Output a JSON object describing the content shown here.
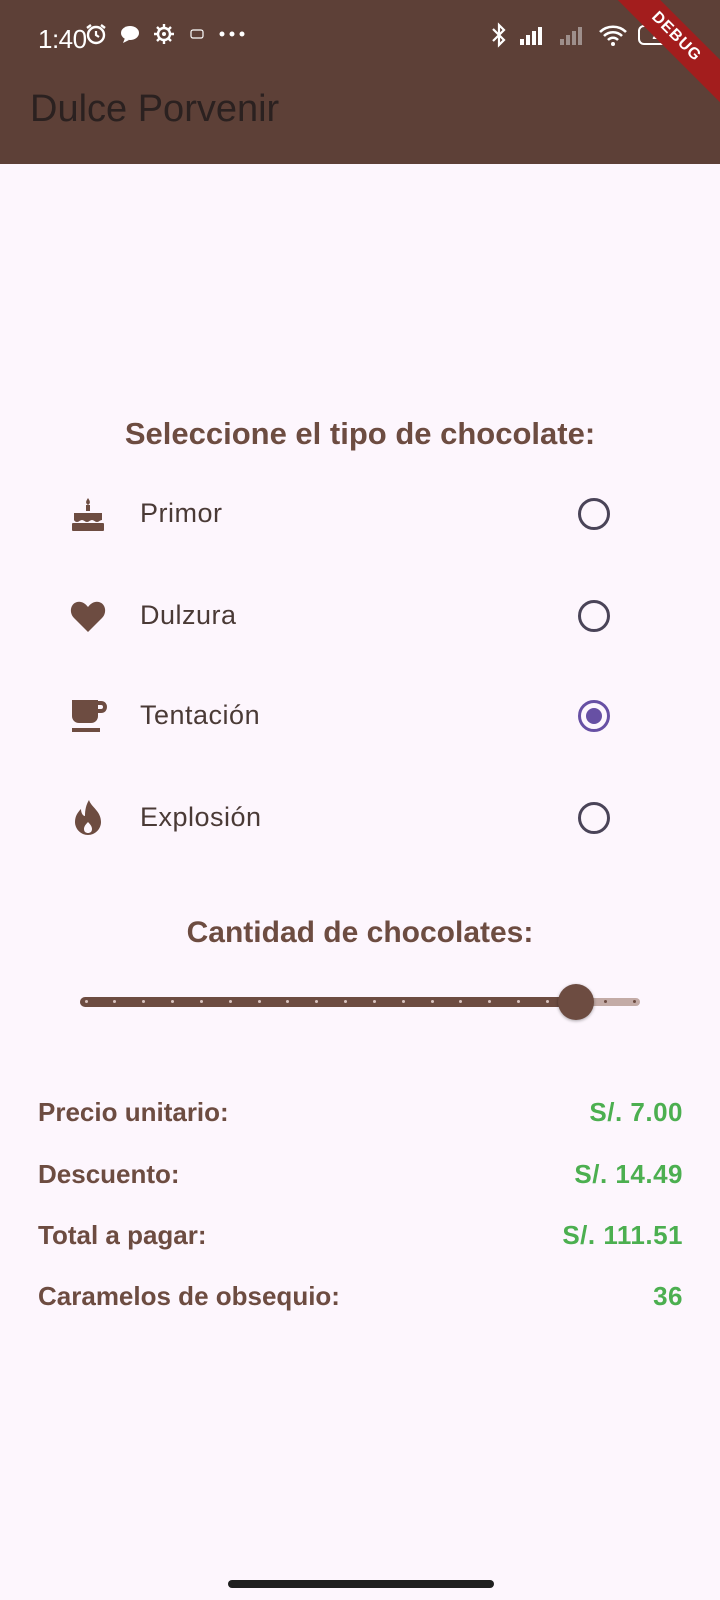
{
  "status_bar": {
    "time": "1:40",
    "battery": "29"
  },
  "app_bar": {
    "title": "Dulce Porvenir",
    "debug_banner": "DEBUG"
  },
  "chocolate_selection": {
    "title": "Seleccione el tipo de chocolate:",
    "selected": "Tentación",
    "options": [
      {
        "label": "Primor",
        "icon": "cake-icon",
        "selected": false
      },
      {
        "label": "Dulzura",
        "icon": "heart-icon",
        "selected": false
      },
      {
        "label": "Tentación",
        "icon": "coffee-cup-icon",
        "selected": true
      },
      {
        "label": "Explosión",
        "icon": "fire-icon",
        "selected": false
      }
    ]
  },
  "quantity": {
    "title": "Cantidad de chocolates:",
    "slider_divisions": 19,
    "slider_fraction": 0.8947
  },
  "summary": {
    "rows": [
      {
        "label": "Precio unitario:",
        "value": "S/. 7.00"
      },
      {
        "label": "Descuento:",
        "value": "S/. 14.49"
      },
      {
        "label": "Total a pagar:",
        "value": "S/. 111.51"
      },
      {
        "label": "Caramelos de obsequio:",
        "value": "36"
      }
    ]
  },
  "colors": {
    "app_bar": "#5d4037",
    "brown_text": "#6d4c41",
    "green_value": "#4caf50",
    "radio_selected": "#6750a4",
    "background": "#fdf6fd"
  }
}
